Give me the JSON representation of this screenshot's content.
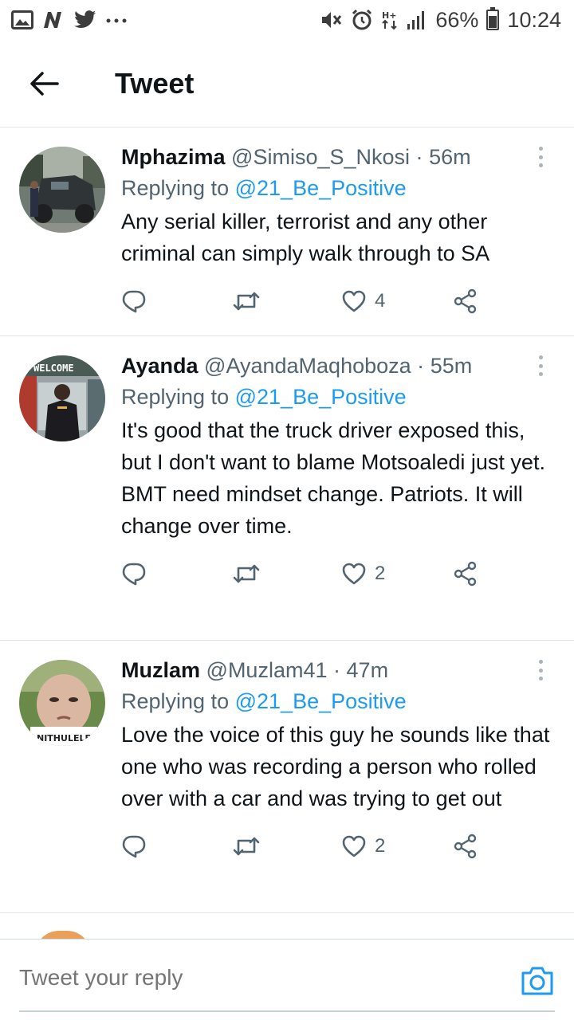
{
  "status_bar": {
    "battery": "66%",
    "time": "10:24",
    "battery_level": 0.66,
    "icons": [
      "gallery-icon",
      "n-icon",
      "twitter-icon",
      "more-dots-icon",
      "mute-icon",
      "alarm-icon",
      "hplus-icon",
      "signal-icon",
      "battery-icon"
    ]
  },
  "header": {
    "title": "Tweet"
  },
  "colors": {
    "accent": "#1d9bf0",
    "text_primary": "#0f1419",
    "text_secondary": "#536471",
    "divider": "#e1e4e6"
  },
  "tweets": [
    {
      "name": "Mphazima",
      "handle": "@Simiso_S_Nkosi",
      "separator": "·",
      "time": "56m",
      "replying_label": "Replying to",
      "replying_to": "@21_Be_Positive",
      "text": "Any serial killer, terrorist and any other criminal can simply walk through to SA",
      "likes": "4"
    },
    {
      "name": "Ayanda",
      "handle": "@AyandaMaqhoboza",
      "separator": "·",
      "time": "55m",
      "replying_label": "Replying to",
      "replying_to": "@21_Be_Positive",
      "text": "It's good that the truck driver exposed this, but I don't want to blame Motsoaledi just yet. BMT need mindset change. Patriots. It will change over time.",
      "likes": "2",
      "avatar_text": "WELCOME"
    },
    {
      "name": "Muzlam",
      "handle": "@Muzlam41",
      "separator": "·",
      "time": "47m",
      "replying_label": "Replying to",
      "replying_to": "@21_Be_Positive",
      "text": "Love the voice of this guy he sounds like that one who was recording a person who rolled over with a car and was trying to get out",
      "likes": "2",
      "avatar_text": "NITHULELENI"
    }
  ],
  "reply_bar": {
    "placeholder": "Tweet your reply"
  }
}
